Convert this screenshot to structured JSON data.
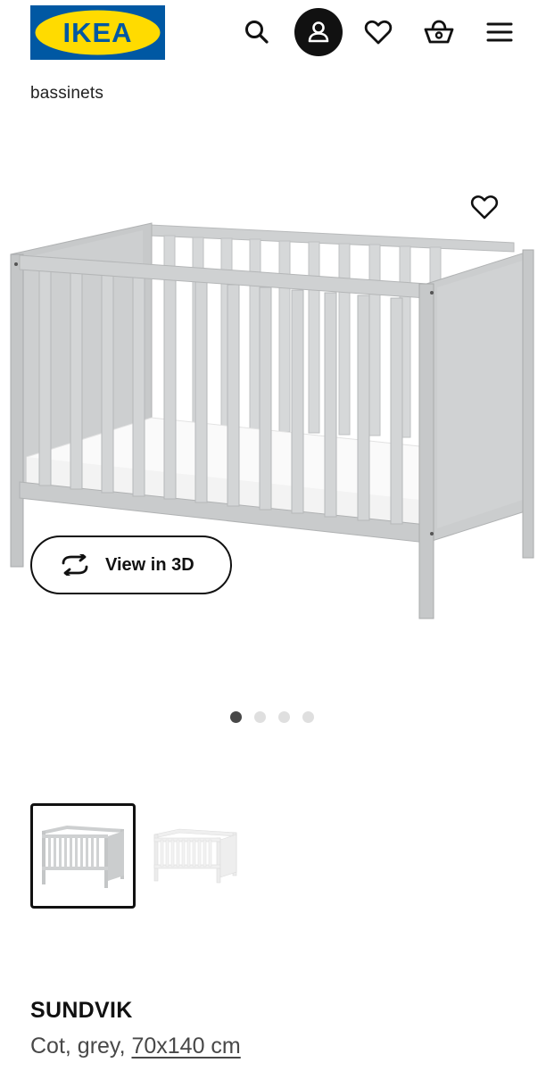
{
  "header": {
    "logo_text": "IKEA",
    "logo_colors": {
      "background": "#0058a3",
      "oval": "#ffdb00",
      "text": "#0058a3"
    },
    "icons": [
      "search-icon",
      "profile-icon",
      "heart-icon",
      "cart-icon",
      "menu-icon"
    ]
  },
  "breadcrumb": {
    "text": "bassinets"
  },
  "product_image": {
    "view3d_label": "View in 3D",
    "favorite_icon": "heart-icon",
    "carousel": {
      "count": 4,
      "active_index": 0
    }
  },
  "thumbnails": [
    {
      "variant": "grey",
      "selected": true,
      "color": "#cdcfd0"
    },
    {
      "variant": "white",
      "selected": false,
      "color": "#f2f2f2"
    }
  ],
  "product": {
    "name": "SUNDVIK",
    "description_prefix": "Cot, grey, ",
    "size": "70x140 cm"
  }
}
